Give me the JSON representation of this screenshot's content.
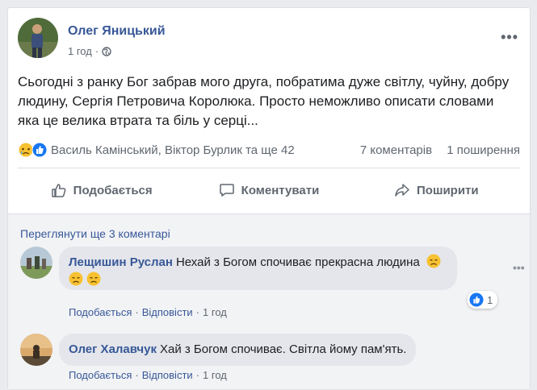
{
  "post": {
    "author": "Олег Яницький",
    "time": "1 год",
    "text": "Сьогодні з ранку Бог забрав мого друга, побратима дуже світлу, чуйну, добру людину, Сергія Петровича Королюка. Просто неможливо описати словами яка це велика втрата та біль у серці...",
    "reactions_summary": "Василь Камінський, Віктор Бурлик та ще 42",
    "comments_count": "7 коментарів",
    "shares_count": "1 поширення"
  },
  "actions": {
    "like": "Подобається",
    "comment": "Коментувати",
    "share": "Поширити"
  },
  "comments": {
    "view_more": "Переглянути ще 3 коментарі",
    "items": [
      {
        "name": "Лещишин Руслан",
        "text": "Нехай з Богом спочиває прекрасна людина",
        "like": "Подобається",
        "reply": "Відповісти",
        "time": "1 год",
        "likes": "1"
      },
      {
        "name": "Олег Халавчук",
        "text": "Хай з Богом спочиває. Світла йому пам'ять.",
        "like": "Подобається",
        "reply": "Відповісти",
        "time": "1 год"
      }
    ]
  },
  "colors": {
    "link": "#385898",
    "like_blue": "#1877f2",
    "sad_yellow": "#f7c131"
  }
}
